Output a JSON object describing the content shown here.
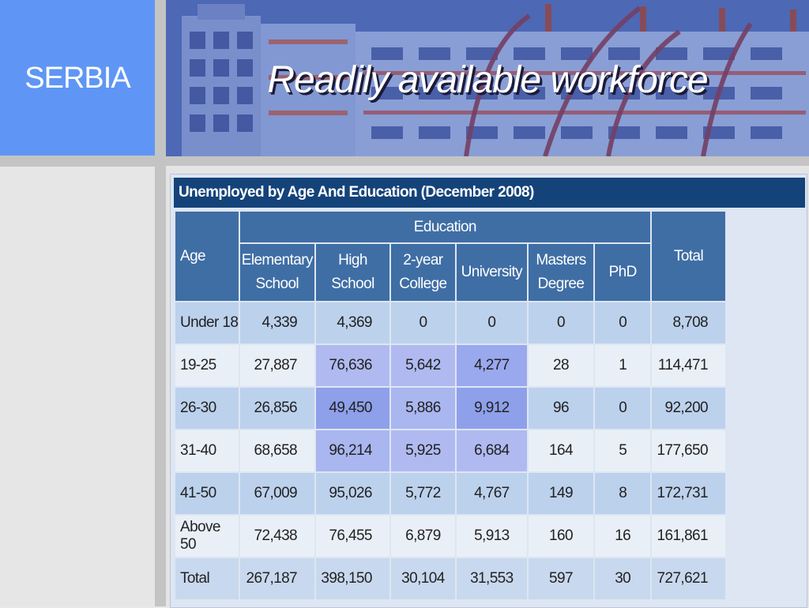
{
  "slide": {
    "country": "SERBIA",
    "title": "Readily available workforce"
  },
  "table": {
    "caption": "Unemployed by Age And Education (December 2008)",
    "age_header": "Age",
    "education_header": "Education",
    "total_header": "Total",
    "columns": [
      {
        "line1": "Elementary",
        "line2": "School"
      },
      {
        "line1": "High",
        "line2": "School"
      },
      {
        "line1": "2-year",
        "line2": "College"
      },
      {
        "line1": "University",
        "line2": ""
      },
      {
        "line1": "Masters",
        "line2": "Degree"
      },
      {
        "line1": "PhD",
        "line2": ""
      }
    ],
    "rows": [
      {
        "age": "Under 18",
        "values": [
          "4,339",
          "4,369",
          "0",
          "0",
          "0",
          "0"
        ],
        "total": "8,708"
      },
      {
        "age": "19-25",
        "values": [
          "27,887",
          "76,636",
          "5,642",
          "4,277",
          "28",
          "1"
        ],
        "total": "114,471"
      },
      {
        "age": "26-30",
        "values": [
          "26,856",
          "49,450",
          "5,886",
          "9,912",
          "96",
          "0"
        ],
        "total": "92,200"
      },
      {
        "age": "31-40",
        "values": [
          "68,658",
          "96,214",
          "5,925",
          "6,684",
          "164",
          "5"
        ],
        "total": "177,650"
      },
      {
        "age": "41-50",
        "values": [
          "67,009",
          "95,026",
          "5,772",
          "4,767",
          "149",
          "8"
        ],
        "total": "172,731"
      },
      {
        "age": "Above 50",
        "values": [
          "72,438",
          "76,455",
          "6,879",
          "5,913",
          "160",
          "16"
        ],
        "total": "161,861"
      },
      {
        "age": "Total",
        "values": [
          "267,187",
          "398,150",
          "30,104",
          "31,553",
          "597",
          "30"
        ],
        "total": "727,621"
      }
    ]
  },
  "colors": {
    "accent_blue": "#5f96f5",
    "caption_navy": "#14437a",
    "header_blue": "#3f6ea5",
    "highlight_purple": "#a9b6ef"
  }
}
